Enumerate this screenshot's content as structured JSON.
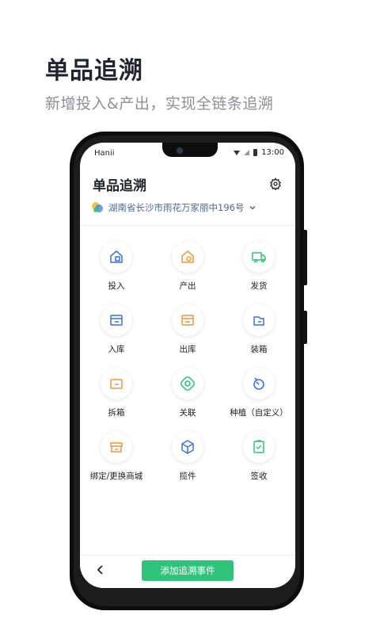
{
  "hero": {
    "title": "单品追溯",
    "subtitle": "新增投入&产出，实现全链条追溯"
  },
  "status_bar": {
    "carrier": "Hanii",
    "time": "13:00"
  },
  "app": {
    "title": "单品追溯",
    "location": "湖南省长沙市雨花万家丽中196号",
    "add_button_label": "添加追溯事件"
  },
  "grid_items": [
    {
      "label": "投入",
      "icon": "house-input-icon",
      "color": "#3a6ff0"
    },
    {
      "label": "产出",
      "icon": "house-output-icon",
      "color": "#f0953a"
    },
    {
      "label": "发货",
      "icon": "truck-icon",
      "color": "#2ec47a"
    },
    {
      "label": "入库",
      "icon": "stock-in-icon",
      "color": "#3a6ff0"
    },
    {
      "label": "出库",
      "icon": "stock-out-icon",
      "color": "#f0953a"
    },
    {
      "label": "装箱",
      "icon": "box-pack-icon",
      "color": "#3a6ff0"
    },
    {
      "label": "拆箱",
      "icon": "box-unpack-icon",
      "color": "#f0953a"
    },
    {
      "label": "关联",
      "icon": "link-icon",
      "color": "#2ec47a"
    },
    {
      "label": "种植（自定义）",
      "icon": "plant-icon",
      "color": "#3a6ff0"
    },
    {
      "label": "绑定/更换商城",
      "icon": "store-icon",
      "color": "#f0953a"
    },
    {
      "label": "揽件",
      "icon": "package-icon",
      "color": "#3a6ff0"
    },
    {
      "label": "签收",
      "icon": "sign-icon",
      "color": "#2ec47a"
    }
  ]
}
